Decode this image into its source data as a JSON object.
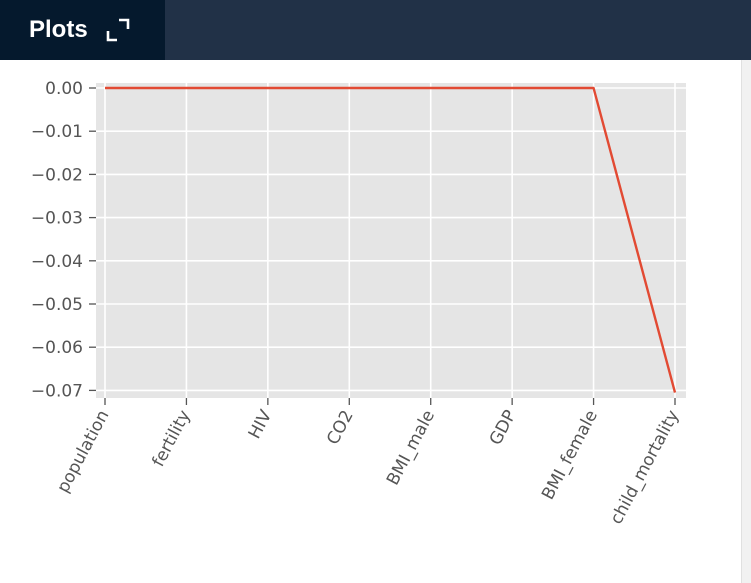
{
  "header": {
    "title": "Plots",
    "expand_icon": "expand-icon"
  },
  "colors": {
    "header_bg": "#213147",
    "tab_active_bg": "#05192d",
    "plot_bg": "#e5e5e5",
    "grid": "#ffffff",
    "line": "#e24a33",
    "tick_text": "#555555"
  },
  "chart_data": {
    "type": "line",
    "categories": [
      "population",
      "fertility",
      "HIV",
      "CO2",
      "BMI_male",
      "GDP",
      "BMI_female",
      "child_mortality"
    ],
    "values": [
      0.0,
      0.0,
      0.0,
      0.0,
      0.0,
      0.0,
      0.0,
      -0.0705
    ],
    "ylim": [
      -0.0705,
      0.0
    ],
    "yticks": [
      0.0,
      -0.01,
      -0.02,
      -0.03,
      -0.04,
      -0.05,
      -0.06,
      -0.07
    ],
    "ytick_labels": [
      "0.00",
      "−0.01",
      "−0.02",
      "−0.03",
      "−0.04",
      "−0.05",
      "−0.06",
      "−0.07"
    ],
    "grid": true,
    "style": "ggplot"
  }
}
